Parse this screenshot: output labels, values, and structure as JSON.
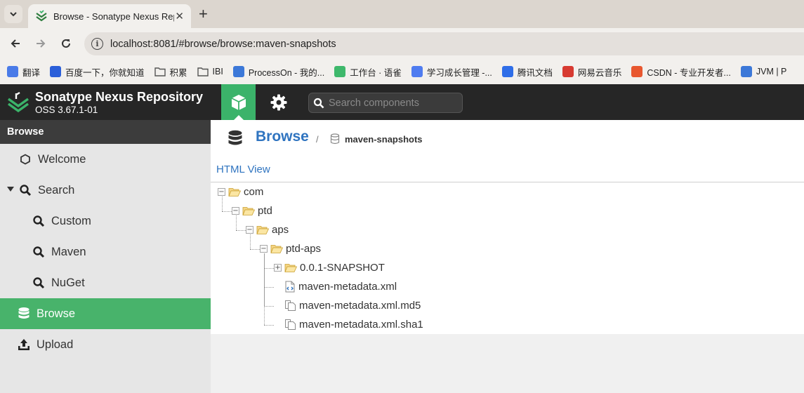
{
  "browser": {
    "tab_title": "Browse - Sonatype Nexus Repository",
    "url": "localhost:8081/#browse/browse:maven-snapshots",
    "bookmarks": [
      {
        "label": "翻译",
        "icon": "translate-icon",
        "color": "#4a7be8"
      },
      {
        "label": "百度一下，你就知道",
        "icon": "baidu-icon",
        "color": "#2b5fd9"
      },
      {
        "label": "积累",
        "icon": "folder-icon",
        "color": "#555555"
      },
      {
        "label": "IBI",
        "icon": "folder-icon",
        "color": "#555555"
      },
      {
        "label": "ProcessOn - 我的...",
        "icon": "processon-icon",
        "color": "#3c78d8"
      },
      {
        "label": "工作台 · 语雀",
        "icon": "yuque-icon",
        "color": "#3eb86b"
      },
      {
        "label": "学习成长管理 -...",
        "icon": "doc-icon",
        "color": "#4f7cf0"
      },
      {
        "label": "腾讯文档",
        "icon": "tencent-docs-icon",
        "color": "#2f6ee8"
      },
      {
        "label": "网易云音乐",
        "icon": "netease-music-icon",
        "color": "#d73a31"
      },
      {
        "label": "CSDN - 专业开发者...",
        "icon": "csdn-icon",
        "color": "#e8572f"
      },
      {
        "label": "JVM | P",
        "icon": "processon-icon",
        "color": "#3c78d8"
      }
    ]
  },
  "header": {
    "title": "Sonatype Nexus Repository",
    "version": "OSS 3.67.1-01",
    "search_placeholder": "Search components"
  },
  "sidebar": {
    "title": "Browse",
    "items": [
      {
        "label": "Welcome",
        "icon": "hexagon-icon"
      },
      {
        "label": "Search",
        "icon": "search-icon"
      },
      {
        "label": "Custom",
        "icon": "search-icon"
      },
      {
        "label": "Maven",
        "icon": "search-icon"
      },
      {
        "label": "NuGet",
        "icon": "search-icon"
      },
      {
        "label": "Browse",
        "icon": "database-icon"
      },
      {
        "label": "Upload",
        "icon": "upload-icon"
      }
    ]
  },
  "main": {
    "breadcrumb_title": "Browse",
    "breadcrumb_sep": "/",
    "repository": "maven-snapshots",
    "html_view": "HTML View",
    "tree": [
      {
        "label": "com",
        "type": "folder",
        "depth": 0
      },
      {
        "label": "ptd",
        "type": "folder",
        "depth": 1
      },
      {
        "label": "aps",
        "type": "folder",
        "depth": 2
      },
      {
        "label": "ptd-aps",
        "type": "folder",
        "depth": 3
      },
      {
        "label": "0.0.1-SNAPSHOT",
        "type": "folder-collapsed",
        "depth": 4
      },
      {
        "label": "maven-metadata.xml",
        "type": "xml-file",
        "depth": 4
      },
      {
        "label": "maven-metadata.xml.md5",
        "type": "file",
        "depth": 4
      },
      {
        "label": "maven-metadata.xml.sha1",
        "type": "file",
        "depth": 4
      }
    ]
  },
  "colors": {
    "accent_green": "#48b36b",
    "header_dark": "#262626",
    "link_blue": "#2f74c0"
  }
}
